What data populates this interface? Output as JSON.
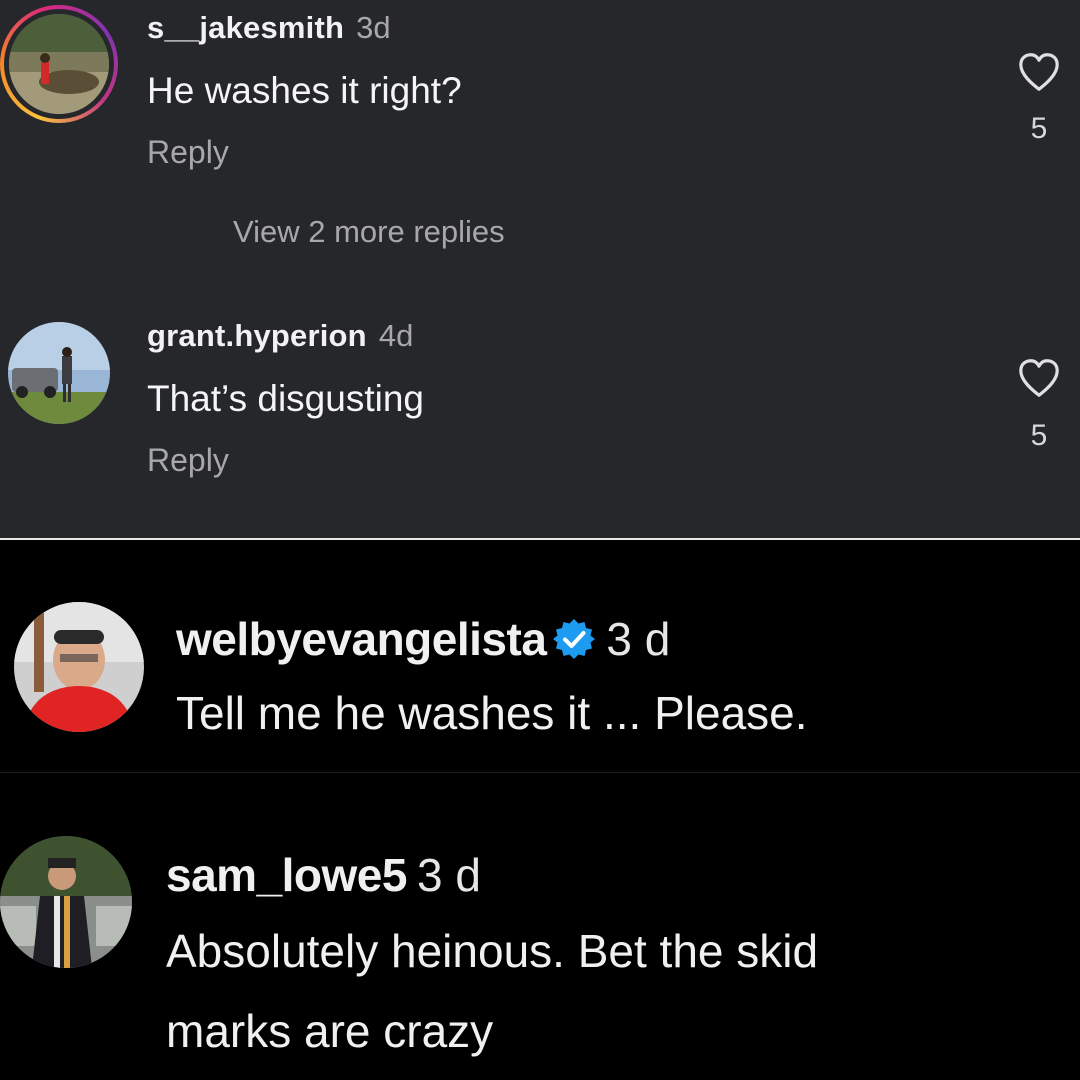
{
  "top_panel": {
    "comments": [
      {
        "username": "s__jakesmith",
        "time": "3d",
        "text": "He washes it right?",
        "reply_label": "Reply",
        "likes": "5"
      },
      {
        "username": "grant.hyperion",
        "time": "4d",
        "text": "That’s disgusting",
        "reply_label": "Reply",
        "likes": "5"
      }
    ],
    "view_more_label": "View 2 more replies"
  },
  "bottom_panel": {
    "comments": [
      {
        "username": "welbyevangelista",
        "verified": true,
        "time": "3 d",
        "text": "Tell me he washes it ... Please."
      },
      {
        "username": "sam_lowe5",
        "time": "3 d",
        "text_line1": "Absolutely heinous. Bet the skid",
        "text_line2": "marks are crazy"
      }
    ]
  },
  "colors": {
    "top_background": "#25272b",
    "bottom_background": "#000000",
    "verified_badge": "#1d9bf0",
    "story_ring": "#dd2a7b"
  }
}
